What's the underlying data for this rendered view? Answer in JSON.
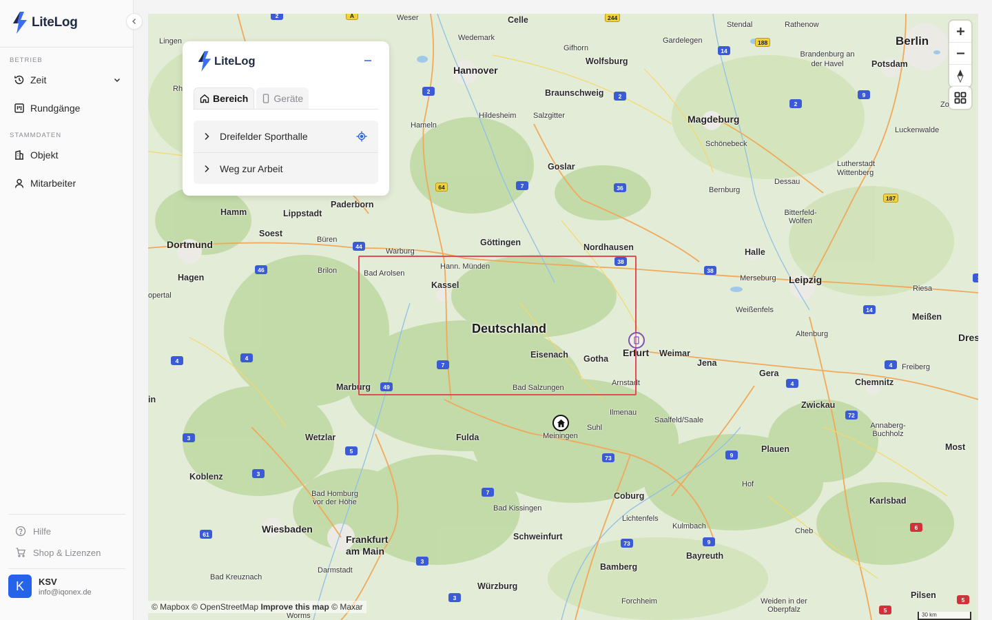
{
  "brand": {
    "name": "LiteLog"
  },
  "sidebar": {
    "sections": [
      {
        "label": "BETRIEB"
      },
      {
        "label": "STAMMDATEN"
      }
    ],
    "items": [
      {
        "label": "Zeit",
        "icon": "clock-icon"
      },
      {
        "label": "Rundgänge",
        "icon": "calendar-board-icon"
      },
      {
        "label": "Objekt",
        "icon": "building-icon"
      },
      {
        "label": "Mitarbeiter",
        "icon": "user-icon"
      }
    ],
    "footer": [
      {
        "label": "Hilfe",
        "icon": "help-circle-icon"
      },
      {
        "label": "Shop & Lizenzen",
        "icon": "cart-icon"
      }
    ],
    "user": {
      "initial": "K",
      "name": "KSV",
      "email": "info@iqonex.de"
    }
  },
  "panel": {
    "brand": "LiteLog",
    "tabs": [
      {
        "label": "Bereich",
        "icon": "home-icon",
        "active": true
      },
      {
        "label": "Geräte",
        "icon": "phone-icon",
        "active": false
      }
    ],
    "areas": [
      {
        "label": "Dreifelder Sporthalle",
        "has_locate": true
      },
      {
        "label": "Weg zur Arbeit",
        "has_locate": false
      }
    ]
  },
  "map": {
    "country_label": "Deutschland",
    "colors": {
      "region_outline": "#e24b55",
      "accent": "#2563eb",
      "device_marker": "#7c4fb8"
    },
    "cities": [
      "Weser",
      "Celle",
      "Lingen",
      "Wedemark",
      "Gifhorn",
      "Wolfsburg",
      "Stendal",
      "Rathenow",
      "Gardelegen",
      "Berlin",
      "Hannover",
      "Brandenburg an der Havel",
      "Potsdam",
      "Braunschweig",
      "Hildesheim",
      "Salzgitter",
      "Hameln",
      "Magdeburg",
      "Zossen",
      "Schönebeck",
      "Luckenwalde",
      "Goslar",
      "Lutherstadt Wittenberg",
      "Dessau",
      "Bernburg",
      "Hamm",
      "Paderborn",
      "Lippstadt",
      "Soest",
      "Dortmund",
      "Büren",
      "Warburg",
      "Göttingen",
      "Nordhausen",
      "Halle",
      "Bitterfeld-Wolfen",
      "Hagen",
      "Brilon",
      "Bad Arolsen",
      "Hann. Münden",
      "Kassel",
      "Merseburg",
      "Leipzig",
      "Riesa",
      "Weißenfels",
      "Meißen",
      "Erfurt",
      "Weimar",
      "Eisenach",
      "Gotha",
      "Jena",
      "Gera",
      "Altenburg",
      "Freiberg",
      "Chemnitz",
      "Zwickau",
      "Marburg",
      "Arnstadt",
      "Bad Salzungen",
      "Ilmenau",
      "Meiningen",
      "Suhl",
      "Saalfeld/Saale",
      "Wetzlar",
      "Fulda",
      "Plauen",
      "Annaberg-Buchholz",
      "Most",
      "Koblenz",
      "Bad Homburg vor der Höhe",
      "Coburg",
      "Hof",
      "Lichtenfels",
      "Kulmbach",
      "Bad Kissingen",
      "Wiesbaden",
      "Frankfurt am Main",
      "Schweinfurt",
      "Karlsbad",
      "Cheb",
      "Darmstadt",
      "Bayreuth",
      "Bamberg",
      "Bad Kreuznach",
      "Würzburg",
      "Forchheim",
      "Weiden in der Oberpfalz",
      "Pilsen",
      "Worms",
      "opertal",
      "Dres",
      "in",
      "Rh"
    ],
    "attribution": {
      "mapbox": "© Mapbox",
      "osm": "© OpenStreetMap",
      "improve": "Improve this map",
      "maxar": "© Maxar"
    },
    "scale_label": "30 km"
  }
}
